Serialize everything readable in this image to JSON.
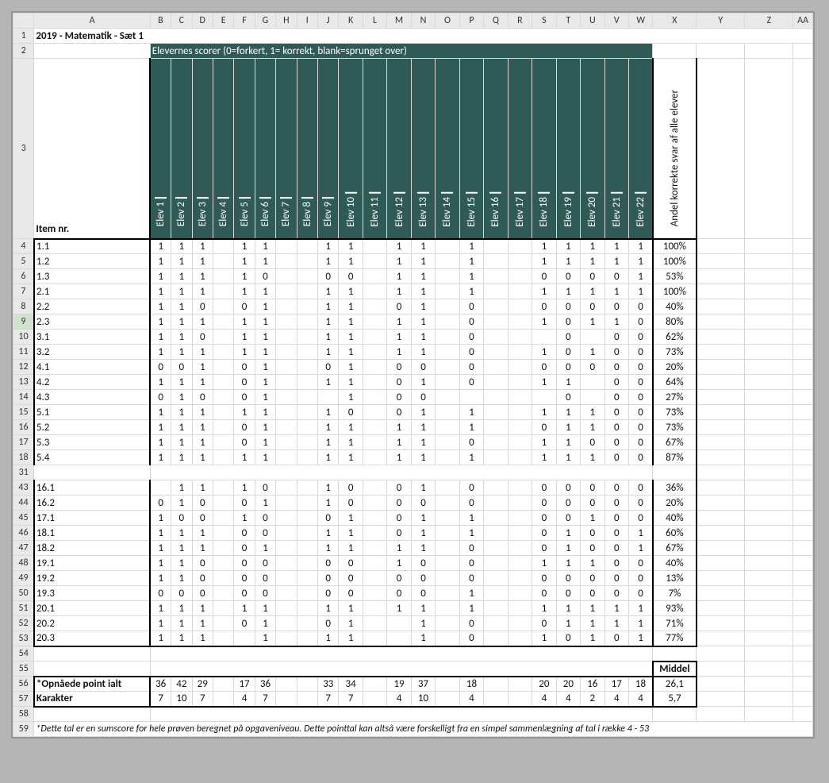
{
  "colLetters": [
    "A",
    "B",
    "C",
    "D",
    "E",
    "F",
    "G",
    "H",
    "I",
    "J",
    "K",
    "L",
    "M",
    "N",
    "O",
    "P",
    "Q",
    "R",
    "S",
    "T",
    "U",
    "V",
    "W",
    "X",
    "Y",
    "Z",
    "AA"
  ],
  "title": "2019 - Matematik - Sæt 1",
  "subtitle": "Elevernes scorer (0=forkert, 1= korrekt, blank=sprunget over)",
  "elevHeaders": [
    "Elev 1",
    "Elev 2",
    "Elev 3",
    "Elev 4",
    "Elev 5",
    "Elev 6",
    "Elev 7",
    "Elev 8",
    "Elev 9",
    "Elev 10",
    "Elev 11",
    "Elev 12",
    "Elev 13",
    "Elev 14",
    "Elev 15",
    "Elev 16",
    "Elev 17",
    "Elev 18",
    "Elev 19",
    "Elev 20",
    "Elev 21",
    "Elev 22"
  ],
  "rowLabelHeader": "Item nr.",
  "pctHeader": "Andel korrekte svar af alle elever",
  "rows": [
    {
      "rn": 4,
      "item": "1.1",
      "v": [
        "1",
        "1",
        "1",
        "",
        "1",
        "1",
        "",
        "",
        "1",
        "1",
        "",
        "1",
        "1",
        "",
        "1",
        "",
        "",
        "1",
        "1",
        "1",
        "1",
        "1"
      ],
      "pct": "100%"
    },
    {
      "rn": 5,
      "item": "1.2",
      "v": [
        "1",
        "1",
        "1",
        "",
        "1",
        "1",
        "",
        "",
        "1",
        "1",
        "",
        "1",
        "1",
        "",
        "1",
        "",
        "",
        "1",
        "1",
        "1",
        "1",
        "1"
      ],
      "pct": "100%"
    },
    {
      "rn": 6,
      "item": "1.3",
      "v": [
        "1",
        "1",
        "1",
        "",
        "1",
        "0",
        "",
        "",
        "0",
        "0",
        "",
        "1",
        "1",
        "",
        "1",
        "",
        "",
        "0",
        "0",
        "0",
        "0",
        "1"
      ],
      "pct": "53%"
    },
    {
      "rn": 7,
      "item": "2.1",
      "v": [
        "1",
        "1",
        "1",
        "",
        "1",
        "1",
        "",
        "",
        "1",
        "1",
        "",
        "1",
        "1",
        "",
        "1",
        "",
        "",
        "1",
        "1",
        "1",
        "1",
        "1"
      ],
      "pct": "100%"
    },
    {
      "rn": 8,
      "item": "2.2",
      "v": [
        "1",
        "1",
        "0",
        "",
        "0",
        "1",
        "",
        "",
        "1",
        "1",
        "",
        "0",
        "1",
        "",
        "0",
        "",
        "",
        "0",
        "0",
        "0",
        "0",
        "0"
      ],
      "pct": "40%"
    },
    {
      "rn": 9,
      "item": "2.3",
      "v": [
        "1",
        "1",
        "1",
        "",
        "1",
        "1",
        "",
        "",
        "1",
        "1",
        "",
        "1",
        "1",
        "",
        "0",
        "",
        "",
        "1",
        "0",
        "1",
        "1",
        "0"
      ],
      "pct": "80%",
      "sel": true
    },
    {
      "rn": 10,
      "item": "3.1",
      "v": [
        "1",
        "1",
        "0",
        "",
        "1",
        "1",
        "",
        "",
        "1",
        "1",
        "",
        "1",
        "1",
        "",
        "0",
        "",
        "",
        "",
        "0",
        "",
        "0",
        "0"
      ],
      "pct": "62%"
    },
    {
      "rn": 11,
      "item": "3.2",
      "v": [
        "1",
        "1",
        "1",
        "",
        "1",
        "1",
        "",
        "",
        "1",
        "1",
        "",
        "1",
        "1",
        "",
        "0",
        "",
        "",
        "1",
        "0",
        "1",
        "0",
        "0"
      ],
      "pct": "73%"
    },
    {
      "rn": 12,
      "item": "4.1",
      "v": [
        "0",
        "0",
        "1",
        "",
        "0",
        "1",
        "",
        "",
        "0",
        "1",
        "",
        "0",
        "0",
        "",
        "0",
        "",
        "",
        "0",
        "0",
        "0",
        "0",
        "0"
      ],
      "pct": "20%"
    },
    {
      "rn": 13,
      "item": "4.2",
      "v": [
        "1",
        "1",
        "1",
        "",
        "0",
        "1",
        "",
        "",
        "1",
        "1",
        "",
        "0",
        "1",
        "",
        "0",
        "",
        "",
        "1",
        "1",
        "",
        "0",
        "0"
      ],
      "pct": "64%"
    },
    {
      "rn": 14,
      "item": "4.3",
      "v": [
        "0",
        "1",
        "0",
        "",
        "0",
        "1",
        "",
        "",
        "",
        "1",
        "",
        "0",
        "0",
        "",
        "",
        "",
        "",
        "",
        "0",
        "",
        "0",
        "0"
      ],
      "pct": "27%"
    },
    {
      "rn": 15,
      "item": "5.1",
      "v": [
        "1",
        "1",
        "1",
        "",
        "1",
        "1",
        "",
        "",
        "1",
        "0",
        "",
        "0",
        "1",
        "",
        "1",
        "",
        "",
        "1",
        "1",
        "1",
        "0",
        "0"
      ],
      "pct": "73%"
    },
    {
      "rn": 16,
      "item": "5.2",
      "v": [
        "1",
        "1",
        "1",
        "",
        "0",
        "1",
        "",
        "",
        "1",
        "1",
        "",
        "1",
        "1",
        "",
        "1",
        "",
        "",
        "0",
        "1",
        "1",
        "0",
        "0"
      ],
      "pct": "73%"
    },
    {
      "rn": 17,
      "item": "5.3",
      "v": [
        "1",
        "1",
        "1",
        "",
        "0",
        "1",
        "",
        "",
        "1",
        "1",
        "",
        "1",
        "1",
        "",
        "0",
        "",
        "",
        "1",
        "1",
        "0",
        "0",
        "0"
      ],
      "pct": "67%"
    },
    {
      "rn": 18,
      "item": "5.4",
      "v": [
        "1",
        "1",
        "1",
        "",
        "1",
        "1",
        "",
        "",
        "1",
        "1",
        "",
        "1",
        "1",
        "",
        "1",
        "",
        "",
        "1",
        "1",
        "1",
        "0",
        "0"
      ],
      "pct": "87%"
    }
  ],
  "gapRow": 31,
  "rows2": [
    {
      "rn": 43,
      "item": "16.1",
      "v": [
        "",
        "1",
        "1",
        "",
        "1",
        "0",
        "",
        "",
        "1",
        "0",
        "",
        "0",
        "1",
        "",
        "0",
        "",
        "",
        "0",
        "0",
        "0",
        "0",
        "0"
      ],
      "pct": "36%"
    },
    {
      "rn": 44,
      "item": "16.2",
      "v": [
        "0",
        "1",
        "0",
        "",
        "0",
        "1",
        "",
        "",
        "1",
        "0",
        "",
        "0",
        "0",
        "",
        "0",
        "",
        "",
        "0",
        "0",
        "0",
        "0",
        "0"
      ],
      "pct": "20%"
    },
    {
      "rn": 45,
      "item": "17.1",
      "v": [
        "1",
        "0",
        "0",
        "",
        "1",
        "0",
        "",
        "",
        "0",
        "1",
        "",
        "0",
        "1",
        "",
        "1",
        "",
        "",
        "0",
        "0",
        "1",
        "0",
        "0"
      ],
      "pct": "40%"
    },
    {
      "rn": 46,
      "item": "18.1",
      "v": [
        "1",
        "1",
        "1",
        "",
        "0",
        "0",
        "",
        "",
        "1",
        "1",
        "",
        "0",
        "1",
        "",
        "1",
        "",
        "",
        "0",
        "1",
        "0",
        "0",
        "1"
      ],
      "pct": "60%"
    },
    {
      "rn": 47,
      "item": "18.2",
      "v": [
        "1",
        "1",
        "1",
        "",
        "0",
        "1",
        "",
        "",
        "1",
        "1",
        "",
        "1",
        "1",
        "",
        "0",
        "",
        "",
        "0",
        "1",
        "0",
        "0",
        "1"
      ],
      "pct": "67%"
    },
    {
      "rn": 48,
      "item": "19.1",
      "v": [
        "1",
        "1",
        "0",
        "",
        "0",
        "0",
        "",
        "",
        "0",
        "0",
        "",
        "1",
        "0",
        "",
        "0",
        "",
        "",
        "1",
        "1",
        "1",
        "0",
        "0"
      ],
      "pct": "40%"
    },
    {
      "rn": 49,
      "item": "19.2",
      "v": [
        "1",
        "1",
        "0",
        "",
        "0",
        "0",
        "",
        "",
        "0",
        "0",
        "",
        "0",
        "0",
        "",
        "0",
        "",
        "",
        "0",
        "0",
        "0",
        "0",
        "0"
      ],
      "pct": "13%"
    },
    {
      "rn": 50,
      "item": "19.3",
      "v": [
        "0",
        "0",
        "0",
        "",
        "0",
        "0",
        "",
        "",
        "0",
        "0",
        "",
        "0",
        "0",
        "",
        "1",
        "",
        "",
        "0",
        "0",
        "0",
        "0",
        "0"
      ],
      "pct": "7%"
    },
    {
      "rn": 51,
      "item": "20.1",
      "v": [
        "1",
        "1",
        "1",
        "",
        "1",
        "1",
        "",
        "",
        "1",
        "1",
        "",
        "1",
        "1",
        "",
        "1",
        "",
        "",
        "1",
        "1",
        "1",
        "1",
        "1"
      ],
      "pct": "93%"
    },
    {
      "rn": 52,
      "item": "20.2",
      "v": [
        "1",
        "1",
        "1",
        "",
        "0",
        "1",
        "",
        "",
        "0",
        "1",
        "",
        "",
        "1",
        "",
        "0",
        "",
        "",
        "0",
        "1",
        "1",
        "1",
        "1"
      ],
      "pct": "71%"
    },
    {
      "rn": 53,
      "item": "20.3",
      "v": [
        "1",
        "1",
        "1",
        "",
        "",
        "1",
        "",
        "",
        "1",
        "1",
        "",
        "",
        "1",
        "",
        "0",
        "",
        "",
        "1",
        "0",
        "1",
        "0",
        "1"
      ],
      "pct": "77%"
    }
  ],
  "emptyRows": [
    54,
    55
  ],
  "middelLabel": "Middel",
  "sumRow": {
    "rn": 56,
    "label": "*Opnåede point ialt",
    "v": [
      "36",
      "42",
      "29",
      "",
      "17",
      "36",
      "",
      "",
      "33",
      "34",
      "",
      "19",
      "37",
      "",
      "18",
      "",
      "",
      "20",
      "20",
      "16",
      "17",
      "18"
    ],
    "m": "26,1"
  },
  "gradeRow": {
    "rn": 57,
    "label": "Karakter",
    "v": [
      "7",
      "10",
      "7",
      "",
      "4",
      "7",
      "",
      "",
      "7",
      "7",
      "",
      "4",
      "10",
      "",
      "4",
      "",
      "",
      "4",
      "4",
      "2",
      "4",
      "4"
    ],
    "m": "5,7"
  },
  "blankRow": 58,
  "footNoteRow": 59,
  "footNote": "*Dette tal er en sumscore for hele prøven beregnet på opgaveniveau. Dette pointtal kan altså være forskelligt fra en simpel sammenlægning af tal i række 4 - 53"
}
